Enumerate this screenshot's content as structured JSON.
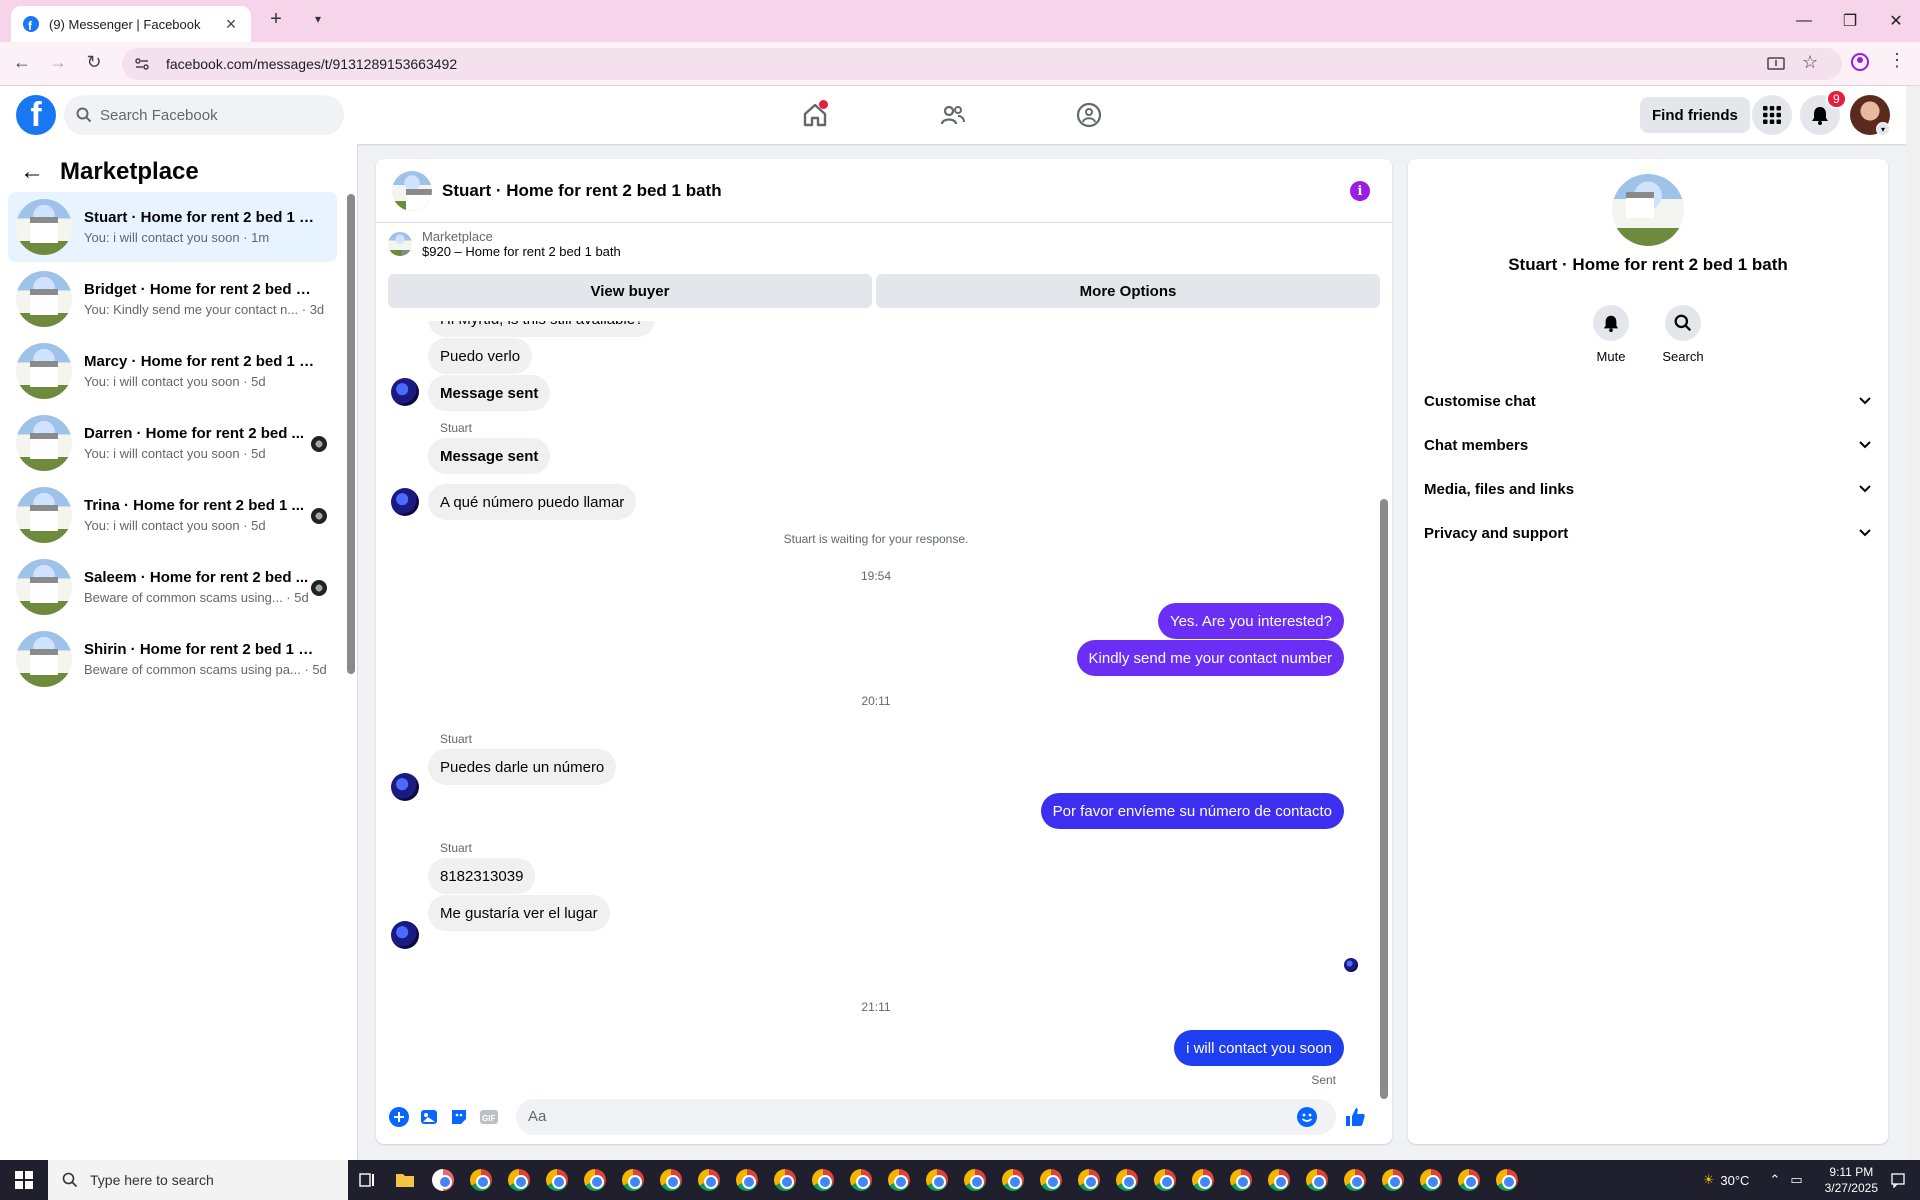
{
  "browser": {
    "tab_title": "(9) Messenger | Facebook",
    "url": "facebook.com/messages/t/9131289153663492"
  },
  "fb": {
    "search_placeholder": "Search Facebook",
    "find_friends": "Find friends",
    "notifications_count": "9"
  },
  "left": {
    "title": "Marketplace",
    "conversations": [
      {
        "name": "Stuart · Home for rent 2 bed 1 b...",
        "sub": "You: i will contact you soon · 1m"
      },
      {
        "name": "Bridget · Home for rent 2 bed 1 ...",
        "sub": "You: Kindly send me your contact n... · 3d"
      },
      {
        "name": "Marcy · Home for rent 2 bed 1 b...",
        "sub": "You: i will contact you soon · 5d"
      },
      {
        "name": "Darren · Home for rent 2 bed ...",
        "sub": "You: i will contact you soon · 5d"
      },
      {
        "name": "Trina · Home for rent 2 bed 1 ...",
        "sub": "You: i will contact you soon · 5d"
      },
      {
        "name": "Saleem · Home for rent 2 bed ...",
        "sub": "Beware of common scams using... · 5d"
      },
      {
        "name": "Shirin · Home for rent 2 bed 1 b...",
        "sub": "Beware of common scams using pa... · 5d"
      }
    ]
  },
  "chat": {
    "title": "Stuart · Home for rent 2 bed 1 bath",
    "listing_caption": "Marketplace",
    "listing_title": "$920 – Home for rent 2 bed 1 bath",
    "view_buyer": "View buyer",
    "more_options": "More Options",
    "messages": {
      "m0": "Hi Myrtid, is this still available?",
      "m1": "Puedo verlo",
      "m2": "Message sent",
      "sender1": "Stuart",
      "m3": "Message sent",
      "m4": "A qué número puedo llamar",
      "waiting": "Stuart is waiting for your response.",
      "t1": "19:54",
      "m5": "Yes. Are you interested?",
      "m6": "Kindly send me your contact number",
      "t2": "20:11",
      "sender2": "Stuart",
      "m7": "Puedes darle un número",
      "m8": "Por favor envíeme su número de contacto",
      "sender3": "Stuart",
      "m9": "8182313039",
      "m10": "Me gustaría ver el lugar",
      "t3": "21:11",
      "m11": "i will contact you soon",
      "status": "Sent"
    },
    "input_placeholder": "Aa"
  },
  "right": {
    "name": "Stuart · Home for rent 2 bed 1 bath",
    "mute": "Mute",
    "search": "Search",
    "sections": [
      "Customise chat",
      "Chat members",
      "Media, files and links",
      "Privacy and support"
    ]
  },
  "taskbar": {
    "search_placeholder": "Type here to search",
    "temperature": "30°C",
    "time": "9:11 PM",
    "date": "3/27/2025"
  },
  "colors": {
    "fb_blue": "#1877f2",
    "outgoing_bubble": "#6b2ef5",
    "info_purple": "#9b1de0"
  }
}
